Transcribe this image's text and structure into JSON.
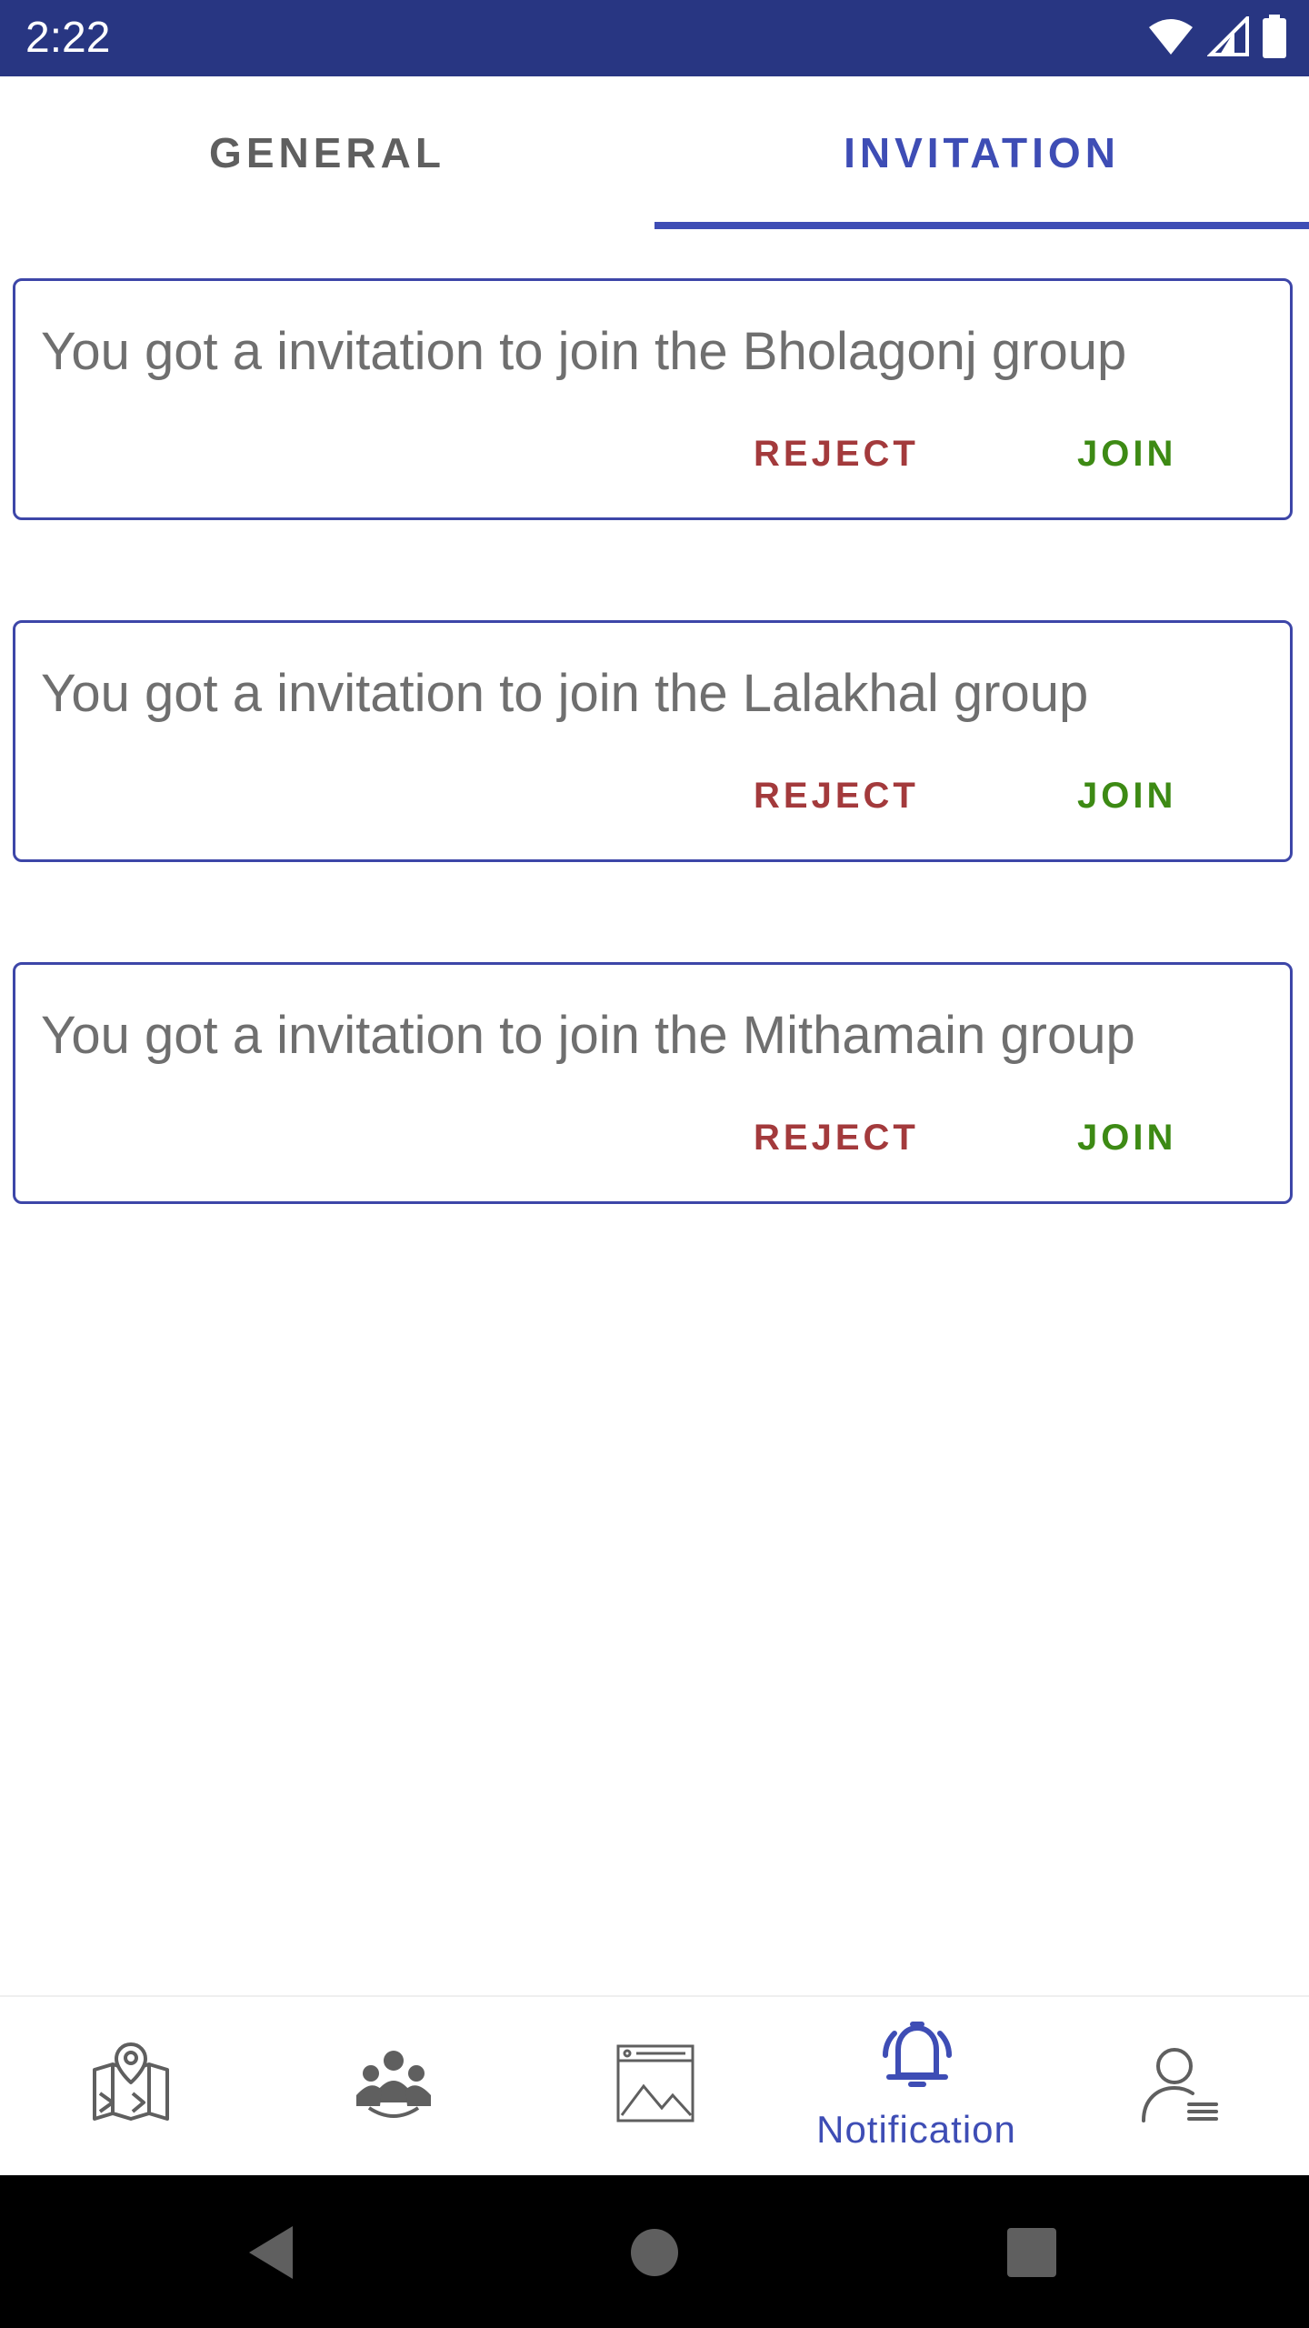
{
  "status_bar": {
    "time": "2:22",
    "icons": [
      "wifi-icon",
      "signal-icon",
      "battery-icon"
    ],
    "background": "#283682"
  },
  "tabs": [
    {
      "label": "GENERAL",
      "selected": false
    },
    {
      "label": "INVITATION",
      "selected": true
    }
  ],
  "invitations": [
    {
      "message": "You got a invitation to join the Bholagonj group",
      "reject_label": "REJECT",
      "join_label": "JOIN"
    },
    {
      "message": "You got a invitation to join the Lalakhal group",
      "reject_label": "REJECT",
      "join_label": "JOIN"
    },
    {
      "message": "You got a invitation to join the Mithamain group",
      "reject_label": "REJECT",
      "join_label": "JOIN"
    }
  ],
  "bottom_nav": {
    "items": [
      {
        "icon": "map-icon",
        "label": "",
        "active": false
      },
      {
        "icon": "group-icon",
        "label": "",
        "active": false
      },
      {
        "icon": "gallery-icon",
        "label": "",
        "active": false
      },
      {
        "icon": "bell-icon",
        "label": "Notification",
        "active": true
      },
      {
        "icon": "profile-menu-icon",
        "label": "",
        "active": false
      }
    ]
  },
  "system_nav": [
    "back-icon",
    "home-icon",
    "recents-icon"
  ],
  "colors": {
    "accent": "#3e4db5",
    "reject": "#a33a3c",
    "join": "#3d8a14",
    "card_border": "#3d46a8"
  }
}
